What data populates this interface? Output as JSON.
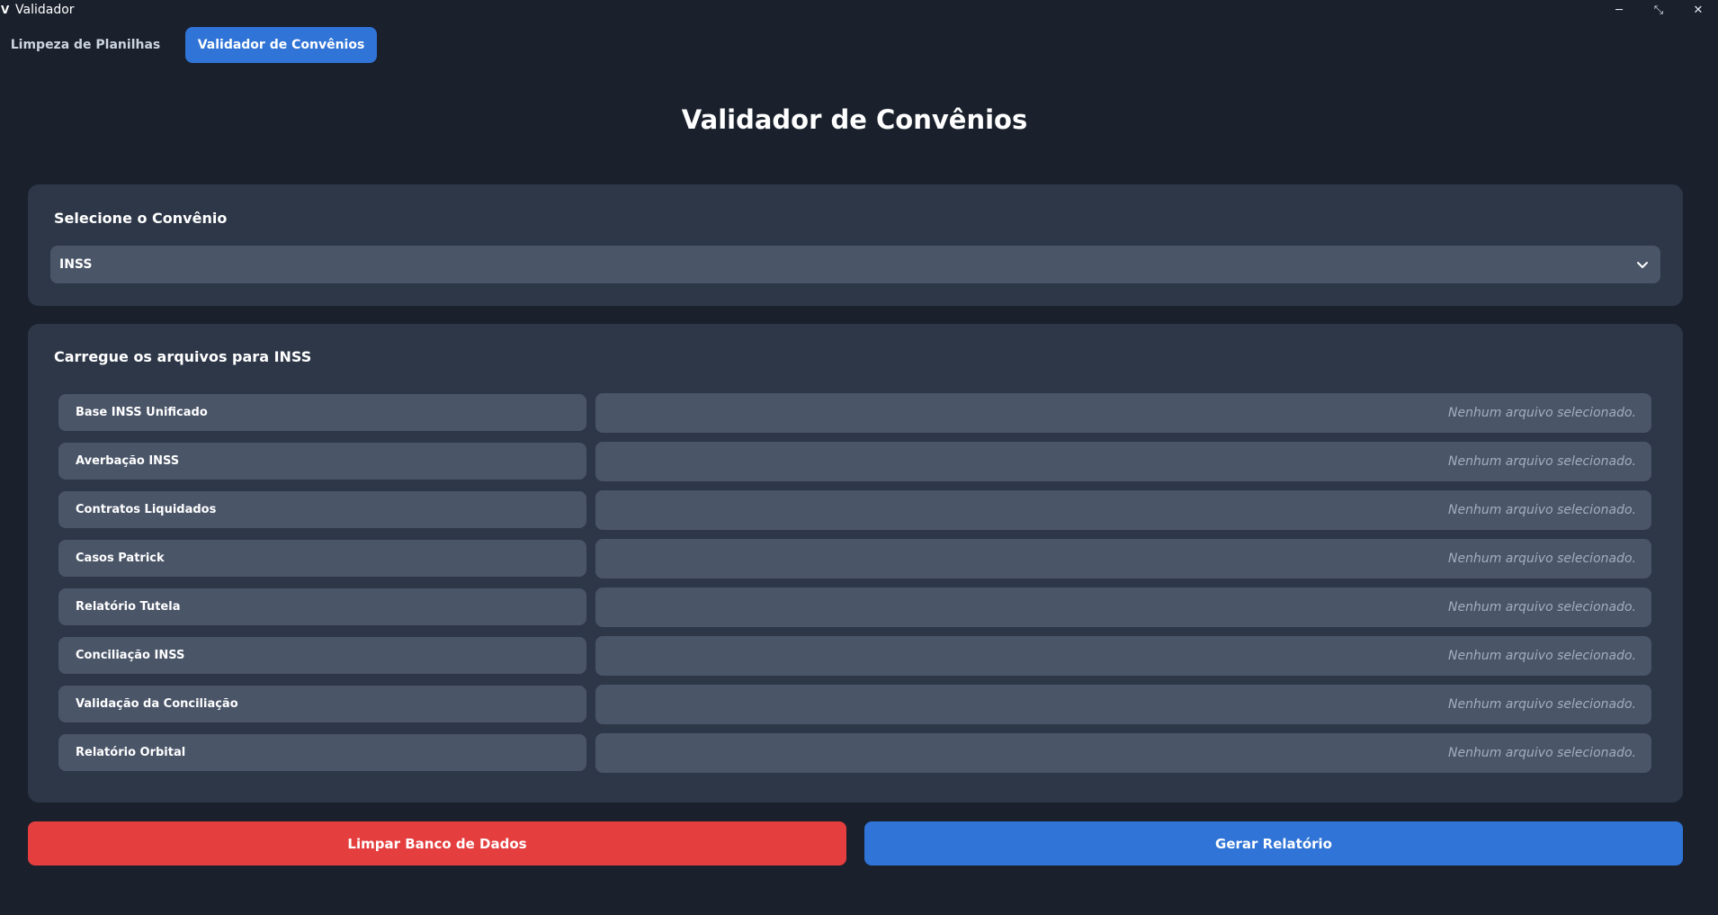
{
  "window": {
    "icon_glyph": "V",
    "title": "Validador",
    "controls": {
      "minimize_glyph": "─",
      "restore_glyph": "⤡",
      "close_glyph": "✕"
    }
  },
  "tabs": [
    {
      "label": "Limpeza de Planilhas",
      "active": false
    },
    {
      "label": "Validador de Convênios",
      "active": true
    }
  ],
  "main": {
    "title": "Validador de Convênios",
    "select_section": {
      "title": "Selecione o Convênio",
      "selected": "INSS"
    },
    "files_section": {
      "title": "Carregue os arquivos para INSS",
      "rows": [
        {
          "label": "Base INSS Unificado",
          "status": "Nenhum arquivo selecionado."
        },
        {
          "label": "Averbação INSS",
          "status": "Nenhum arquivo selecionado."
        },
        {
          "label": "Contratos Liquidados",
          "status": "Nenhum arquivo selecionado."
        },
        {
          "label": "Casos Patrick",
          "status": "Nenhum arquivo selecionado."
        },
        {
          "label": "Relatório Tutela",
          "status": "Nenhum arquivo selecionado."
        },
        {
          "label": "Conciliação INSS",
          "status": "Nenhum arquivo selecionado."
        },
        {
          "label": "Validação da Conciliação",
          "status": "Nenhum arquivo selecionado."
        },
        {
          "label": "Relatório Orbital",
          "status": "Nenhum arquivo selecionado."
        }
      ]
    }
  },
  "actions": {
    "clear_label": "Limpar Banco de Dados",
    "report_label": "Gerar Relatório"
  },
  "colors": {
    "background": "#1a202c",
    "card": "#2d3748",
    "field": "#4a5568",
    "accent_blue": "#2f74d6",
    "danger_red": "#e53e3e"
  }
}
